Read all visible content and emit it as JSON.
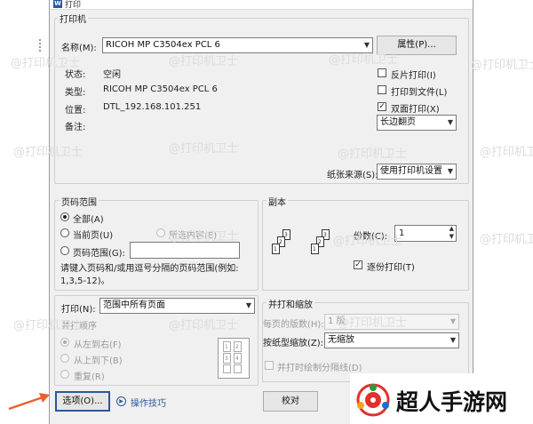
{
  "window": {
    "title": "打印",
    "app_icon": "W"
  },
  "printer_group": {
    "label": "打印机",
    "name_label": "名称(M):",
    "name_value": "RICOH MP C3504ex PCL 6",
    "properties_button": "属性(P)...",
    "status_label": "状态:",
    "status_value": "空闲",
    "type_label": "类型:",
    "type_value": "RICOH MP C3504ex PCL 6",
    "location_label": "位置:",
    "location_value": "DTL_192.168.101.251",
    "comment_label": "备注:",
    "reverse_print": {
      "label": "反片打印(I)",
      "checked": false
    },
    "print_to_file": {
      "label": "打印到文件(L)",
      "checked": false
    },
    "duplex": {
      "label": "双面打印(X)",
      "checked": true
    },
    "duplex_mode": "长边翻页",
    "paper_source_label": "纸张来源(S):",
    "paper_source_value": "使用打印机设置"
  },
  "page_range": {
    "label": "页码范围",
    "all": "全部(A)",
    "current_page": "当前页(U)",
    "selection": "所选内容(E)",
    "pages": "页码范围(G):",
    "hint": "请键入页码和/或用逗号分隔的页码范围(例如: 1,3,5-12)。",
    "selected": "all"
  },
  "copies": {
    "label": "副本",
    "count_label": "份数(C):",
    "count_value": "1",
    "collate": {
      "label": "逐份打印(T)",
      "checked": true
    }
  },
  "print_what": {
    "label": "打印(N):",
    "value": "范围中所有页面"
  },
  "print_order": {
    "label": "并打顺序",
    "left_to_right": "从左到右(F)",
    "top_to_bottom": "从上到下(B)",
    "repeat": "重复(R)"
  },
  "zoom": {
    "label": "并打和缩放",
    "pages_per_sheet_label": "每页的版数(H):",
    "pages_per_sheet_value": "1 版",
    "scale_label": "按纸型缩放(Z):",
    "scale_value": "无缩放",
    "draw_lines": {
      "label": "并打时绘制分隔线(D)",
      "checked": false
    }
  },
  "footer": {
    "options_button": "选项(O)...",
    "tips_link": "操作技巧",
    "proofread_button": "校对"
  },
  "watermark_text": "@打印机卫士",
  "brand": {
    "name": "超人手游网"
  },
  "colors": {
    "accent": "#2b579a",
    "arrow": "#e8612c",
    "brand_red": "#e0312e"
  }
}
